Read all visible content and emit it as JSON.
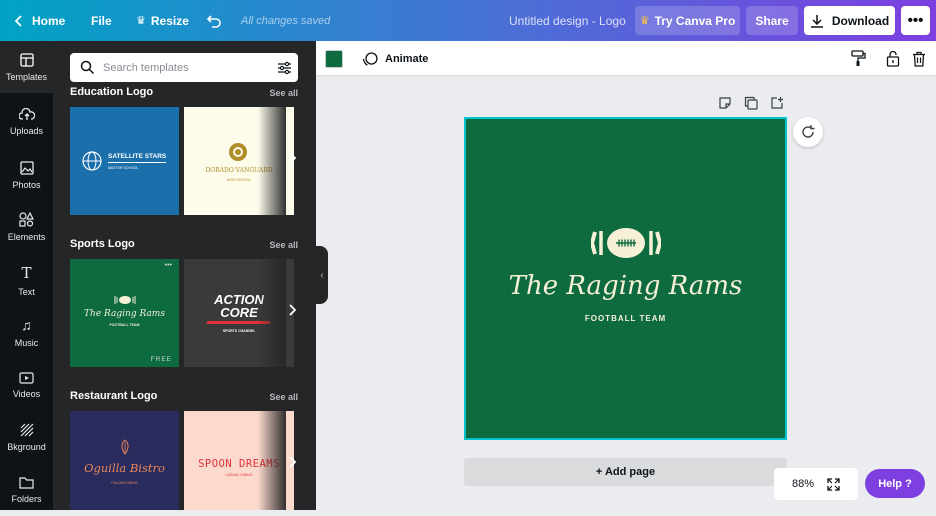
{
  "topbar": {
    "home_label": "Home",
    "file_label": "File",
    "resize_label": "Resize",
    "saved_status": "All changes saved",
    "doc_title": "Untitled design - Logo",
    "try_pro_label": "Try Canva Pro",
    "share_label": "Share",
    "download_label": "Download"
  },
  "rail": {
    "items": [
      {
        "label": "Templates",
        "icon": "templates-icon"
      },
      {
        "label": "Uploads",
        "icon": "upload-cloud-icon"
      },
      {
        "label": "Photos",
        "icon": "photo-icon"
      },
      {
        "label": "Elements",
        "icon": "shapes-icon"
      },
      {
        "label": "Text",
        "icon": "text-icon"
      },
      {
        "label": "Music",
        "icon": "music-note-icon"
      },
      {
        "label": "Videos",
        "icon": "video-icon"
      },
      {
        "label": "Bkground",
        "icon": "background-icon"
      },
      {
        "label": "Folders",
        "icon": "folder-icon"
      }
    ]
  },
  "panel": {
    "search_placeholder": "Search templates",
    "sections": [
      {
        "title": "Education Logo",
        "see_all": "See all",
        "tiles": [
          {
            "name": "SATELLITE STARS",
            "sub": "MASTER SCHOOL",
            "bg": "#1b6fab",
            "fg": "#ffffff"
          },
          {
            "name": "DORADO VANGUARD",
            "sub": "HIGH SCHOOL",
            "bg": "#fdfbea",
            "fg": "#b08d2a"
          }
        ]
      },
      {
        "title": "Sports Logo",
        "see_all": "See all",
        "tiles": [
          {
            "name": "The Raging Rams",
            "sub": "FOOTBALL TEAM",
            "badge": "FREE",
            "bg": "#0d6b3f",
            "fg": "#f5f0d6"
          },
          {
            "name": "ACTION",
            "name2": "CORE",
            "sub": "SPORTS CHANNEL",
            "bg": "#3a3a3a",
            "fg": "#ffffff"
          }
        ]
      },
      {
        "title": "Restaurant Logo",
        "see_all": "See all",
        "tiles": [
          {
            "name": "Oguilla Bistro",
            "sub": "ITALIAN DINING",
            "bg": "#2a2c5e",
            "fg": "#e8875a"
          },
          {
            "name": "SPOON DREAMS",
            "sub": "CASUAL DINING",
            "bg": "#fbd9cc",
            "fg": "#e0323a"
          }
        ]
      }
    ]
  },
  "context_bar": {
    "fill_color": "#0d6b3f",
    "animate_label": "Animate"
  },
  "design": {
    "bg": "#0d6b3f",
    "title": "The Raging Rams",
    "subtitle": "FOOTBALL TEAM",
    "fg": "#f5f0d6"
  },
  "canvas": {
    "add_page_label": "+ Add page",
    "zoom_level": "88%",
    "help_label": "Help ?"
  }
}
